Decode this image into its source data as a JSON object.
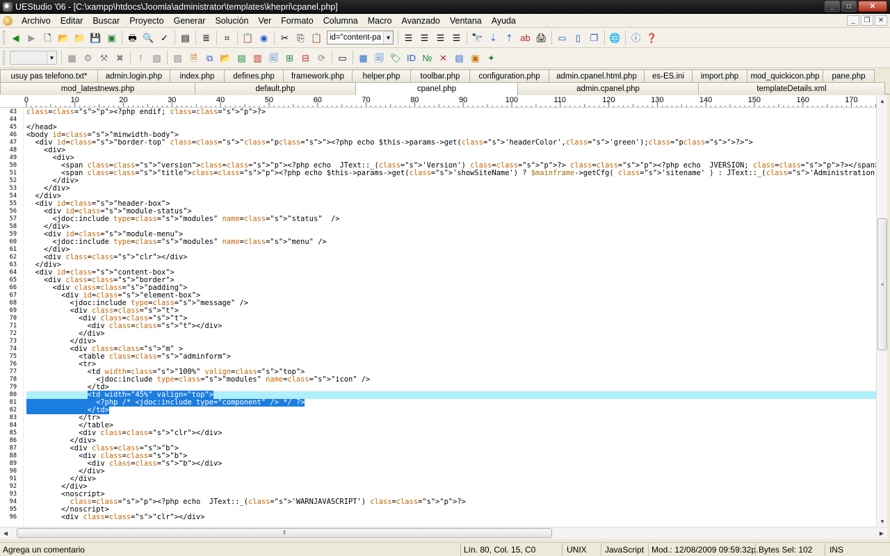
{
  "window": {
    "title": "UEStudio '06 - [C:\\xampp\\htdocs\\Joomla\\administrator\\templates\\khepri\\cpanel.php]"
  },
  "menu": [
    "Archivo",
    "Editar",
    "Buscar",
    "Proyecto",
    "Generar",
    "Solución",
    "Ver",
    "Formato",
    "Columna",
    "Macro",
    "Avanzado",
    "Ventana",
    "Ayuda"
  ],
  "toolbar": {
    "function_combo": "id=\"content-pa"
  },
  "tabs_row1": [
    "usuy pas telefono.txt*",
    "admin.login.php",
    "index.php",
    "defines.php",
    "framework.php",
    "helper.php",
    "toolbar.php",
    "configuration.php",
    "admin.cpanel.html.php",
    "es-ES.ini",
    "import.php",
    "mod_quickicon.php",
    "pane.php"
  ],
  "tabs_row2": [
    "mod_latestnews.php",
    "default.php",
    "cpanel.php",
    "admin.cpanel.php",
    "templateDetails.xml"
  ],
  "active_tab": "cpanel.php",
  "ruler": [
    "0",
    "10",
    "20",
    "30",
    "40",
    "50",
    "60",
    "70",
    "80",
    "90",
    "100",
    "110",
    "120",
    "130",
    "140",
    "150",
    "160",
    "170"
  ],
  "code_lines": [
    {
      "n": "43",
      "t": "<?php endif; ?>"
    },
    {
      "n": "44",
      "t": ""
    },
    {
      "n": "45",
      "t": "</head>"
    },
    {
      "n": "46",
      "t": "<body id=\"minwidth-body\">"
    },
    {
      "n": "47",
      "t": "  <div id=\"border-top\" class=\"<?php echo $this->params->get('headerColor','green');?>\">"
    },
    {
      "n": "48",
      "t": "    <div>"
    },
    {
      "n": "49",
      "t": "      <div>"
    },
    {
      "n": "50",
      "t": "        <span class=\"version\"><?php echo  JText::_('Version') ?> <?php echo  JVERSION; ?></span>"
    },
    {
      "n": "51",
      "t": "        <span class=\"title\"><?php echo $this->params->get('showSiteName') ? $mainframe->getCfg( 'sitename' ) : JText::_('Administration'); ?></span>"
    },
    {
      "n": "52",
      "t": "      </div>"
    },
    {
      "n": "53",
      "t": "    </div>"
    },
    {
      "n": "54",
      "t": "  </div>"
    },
    {
      "n": "55",
      "t": "  <div id=\"header-box\">"
    },
    {
      "n": "56",
      "t": "    <div id=\"module-status\">"
    },
    {
      "n": "57",
      "t": "      <jdoc:include type=\"modules\" name=\"status\"  />"
    },
    {
      "n": "58",
      "t": "    </div>"
    },
    {
      "n": "59",
      "t": "    <div id=\"module-menu\">"
    },
    {
      "n": "60",
      "t": "      <jdoc:include type=\"modules\" name=\"menu\" />"
    },
    {
      "n": "61",
      "t": "    </div>"
    },
    {
      "n": "62",
      "t": "    <div class=\"clr\"></div>"
    },
    {
      "n": "63",
      "t": "  </div>"
    },
    {
      "n": "64",
      "t": "  <div id=\"content-box\">"
    },
    {
      "n": "65",
      "t": "    <div class=\"border\">"
    },
    {
      "n": "66",
      "t": "      <div class=\"padding\">"
    },
    {
      "n": "67",
      "t": "        <div id=\"element-box\">"
    },
    {
      "n": "68",
      "t": "          <jdoc:include type=\"message\" />"
    },
    {
      "n": "69",
      "t": "          <div class=\"t\">"
    },
    {
      "n": "70",
      "t": "            <div class=\"t\">"
    },
    {
      "n": "71",
      "t": "              <div class=\"t\"></div>"
    },
    {
      "n": "72",
      "t": "            </div>"
    },
    {
      "n": "73",
      "t": "          </div>"
    },
    {
      "n": "74",
      "t": "          <div class=\"m\" >"
    },
    {
      "n": "75",
      "t": "            <table class=\"adminform\">"
    },
    {
      "n": "76",
      "t": "            <tr>"
    },
    {
      "n": "77",
      "t": "              <td width=\"100%\" valign=\"top\">"
    },
    {
      "n": "78",
      "t": "                <jdoc:include type=\"modules\" name=\"icon\" />"
    },
    {
      "n": "79",
      "t": "              </td>"
    },
    {
      "n": "80",
      "t": "              <td width=\"45%\" valign=\"top\">"
    },
    {
      "n": "81",
      "t": "                <?php /* <jdoc:include type=\"component\" /> */ ?>"
    },
    {
      "n": "82",
      "t": "              </td>"
    },
    {
      "n": "83",
      "t": "            </tr>"
    },
    {
      "n": "84",
      "t": "            </table>"
    },
    {
      "n": "85",
      "t": "            <div class=\"clr\"></div>"
    },
    {
      "n": "86",
      "t": "          </div>"
    },
    {
      "n": "87",
      "t": "          <div class=\"b\">"
    },
    {
      "n": "88",
      "t": "            <div class=\"b\">"
    },
    {
      "n": "89",
      "t": "              <div class=\"b\"></div>"
    },
    {
      "n": "90",
      "t": "            </div>"
    },
    {
      "n": "91",
      "t": "          </div>"
    },
    {
      "n": "92",
      "t": "        </div>"
    },
    {
      "n": "93",
      "t": "        <noscript>"
    },
    {
      "n": "94",
      "t": "          <?php echo  JText::_('WARNJAVASCRIPT') ?>"
    },
    {
      "n": "95",
      "t": "        </noscript>"
    },
    {
      "n": "96",
      "t": "        <div class=\"clr\"></div>"
    }
  ],
  "selection": {
    "first_line": "80",
    "last_line": "82"
  },
  "status": {
    "hint": "Agrega un comentario",
    "position": "Lín. 80, Col. 15, C0",
    "line_ending": "UNIX",
    "syntax": "JavaScript",
    "modified": "Mod.: 12/08/2009 09:59:32p.",
    "bytes_sel": "Bytes Sel: 102",
    "mode": "INS"
  },
  "colors": {
    "selection": "#1c7de0",
    "current_line": "#aef0f7",
    "string": "#808080",
    "attribute": "#c86400",
    "php_tag": "#c00000"
  }
}
